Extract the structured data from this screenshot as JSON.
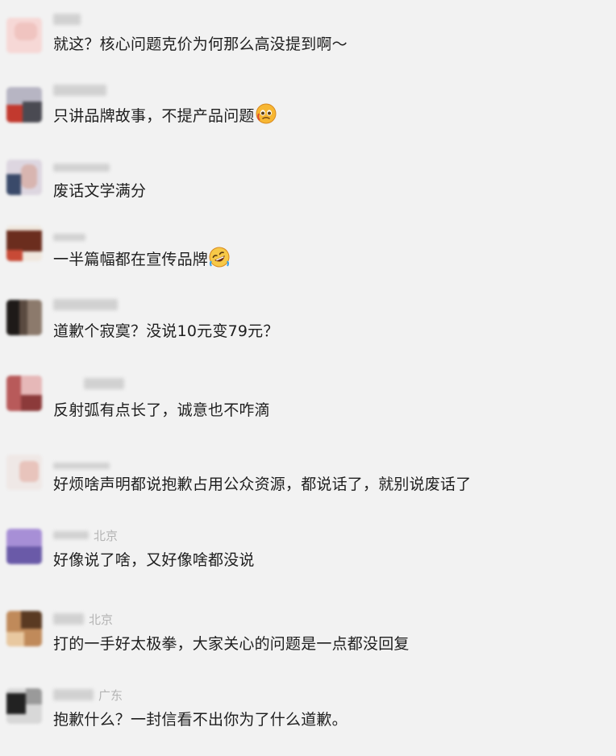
{
  "comments": [
    {
      "text": "就这？核心问题克价为何那么高没提到啊～",
      "location": "",
      "emoji": "",
      "avatar_icon": "avatar-icon"
    },
    {
      "text": "只讲品牌故事，不提产品问题",
      "location": "",
      "emoji": "pleading-face-icon",
      "avatar_icon": "avatar-icon"
    },
    {
      "text": "废话文学满分",
      "location": "",
      "emoji": "",
      "avatar_icon": "avatar-icon"
    },
    {
      "text": "一半篇幅都在宣传品牌",
      "location": "",
      "emoji": "rolling-laughing-face-icon",
      "avatar_icon": "avatar-icon"
    },
    {
      "text": "道歉个寂寞？没说10元变79元？",
      "location": "",
      "emoji": "",
      "avatar_icon": "avatar-icon"
    },
    {
      "text": "反射弧有点长了，诚意也不咋滴",
      "location": "",
      "emoji": "",
      "avatar_icon": "avatar-icon"
    },
    {
      "text": "好烦啥声明都说抱歉占用公众资源，都说话了，就别说废话了",
      "location": "",
      "emoji": "",
      "avatar_icon": "avatar-icon"
    },
    {
      "text": "好像说了啥，又好像啥都没说",
      "location": "北京",
      "emoji": "",
      "avatar_icon": "avatar-icon"
    },
    {
      "text": "打的一手好太极拳，大家关心的问题是一点都没回复",
      "location": "北京",
      "emoji": "",
      "avatar_icon": "avatar-icon"
    },
    {
      "text": "抱歉什么？一封信看不出你为了什么道歉。",
      "location": "广东",
      "emoji": "",
      "avatar_icon": "avatar-icon"
    }
  ]
}
